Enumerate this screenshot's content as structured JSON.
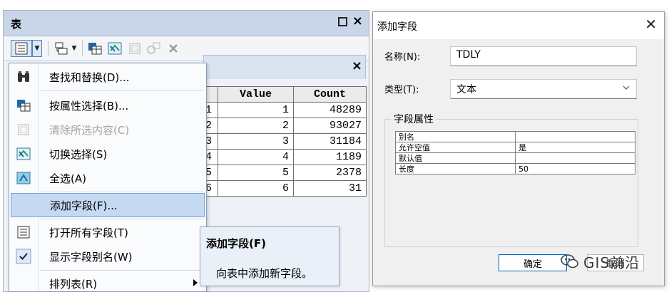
{
  "table_window": {
    "title": "表",
    "toolbar": {
      "icons": [
        "table-options-icon",
        "related-tables-icon",
        "select-by-attributes-icon",
        "switch-selection-icon",
        "clear-selection-icon",
        "zoom-to-selected-icon",
        "delete-selected-icon"
      ]
    },
    "table": {
      "headers": [
        "",
        "Value",
        "Count"
      ],
      "rows": [
        {
          "id": "1",
          "value": "1",
          "count": "48289"
        },
        {
          "id": "2",
          "value": "2",
          "count": "93027"
        },
        {
          "id": "3",
          "value": "3",
          "count": "31184"
        },
        {
          "id": "4",
          "value": "4",
          "count": "1189"
        },
        {
          "id": "5",
          "value": "5",
          "count": "2378"
        },
        {
          "id": "6",
          "value": "6",
          "count": "31"
        }
      ]
    }
  },
  "context_menu": {
    "items": [
      {
        "label": "查找和替换(D)...",
        "icon": "binoculars-icon",
        "disabled": false
      },
      {
        "label": "按属性选择(B)...",
        "icon": "select-by-attributes-icon",
        "disabled": false
      },
      {
        "label": "清除所选内容(C)",
        "icon": "clear-selection-icon",
        "disabled": true
      },
      {
        "label": "切换选择(S)",
        "icon": "switch-selection-icon",
        "disabled": false
      },
      {
        "label": "全选(A)",
        "icon": "select-all-icon",
        "disabled": false
      },
      {
        "label": "添加字段(F)...",
        "icon": "",
        "disabled": false,
        "highlighted": true
      },
      {
        "label": "打开所有字段(T)",
        "icon": "list-icon",
        "disabled": false
      },
      {
        "label": "显示字段别名(W)",
        "icon": "checkmark-icon",
        "disabled": false,
        "checked": true
      },
      {
        "label": "排列表(R)",
        "icon": "",
        "disabled": false,
        "has_submenu": true
      }
    ]
  },
  "tooltip": {
    "title": "添加字段(F)",
    "body": "向表中添加新字段。"
  },
  "dialog": {
    "title": "添加字段",
    "name_label": "名称(N):",
    "name_value": "TDLY",
    "type_label": "类型(T):",
    "type_value": "文本",
    "group_label": "字段属性",
    "properties": [
      {
        "key": "别名",
        "value": ""
      },
      {
        "key": "允许空值",
        "value": "是"
      },
      {
        "key": "默认值",
        "value": ""
      },
      {
        "key": "长度",
        "value": "50"
      }
    ],
    "ok_label": "确定",
    "cancel_label": "取消"
  },
  "watermark": {
    "text": "GIS前沿"
  },
  "colors": {
    "menu_highlight": "#c4d9f2",
    "titlebar": "#c9d6ea",
    "dialog_bg": "#f0f0f0",
    "ok_border": "#0067c0"
  }
}
